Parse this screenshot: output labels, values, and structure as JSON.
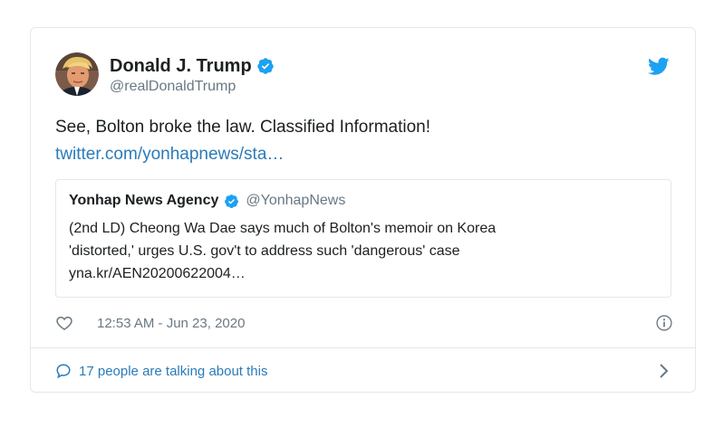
{
  "author": {
    "display_name": "Donald J. Trump",
    "handle": "@realDonaldTrump",
    "verified": true,
    "avatar_icon": "profile-photo"
  },
  "tweet": {
    "text": "See, Bolton broke the law. Classified Information!",
    "link": "twitter.com/yonhapnews/sta…"
  },
  "quoted_tweet": {
    "display_name": "Yonhap News Agency",
    "handle": "@YonhapNews",
    "verified": true,
    "lines": [
      "(2nd LD) Cheong Wa Dae says much of Bolton's memoir on Korea",
      "'distorted,' urges U.S. gov't to address such 'dangerous' case",
      "yna.kr/AEN20200622004…"
    ]
  },
  "meta": {
    "timestamp": "12:53 AM - Jun 23, 2020",
    "like_icon": "heart-icon",
    "info_icon": "info-icon"
  },
  "footer": {
    "conversation_text": "17 people are talking about this",
    "chat_icon": "chat-bubble-icon",
    "chevron_icon": "chevron-right-icon"
  },
  "colors": {
    "twitter_blue": "#1da1f2",
    "link_blue": "#2b7bb9",
    "secondary_text": "#697882",
    "border": "#e1e8ed"
  }
}
